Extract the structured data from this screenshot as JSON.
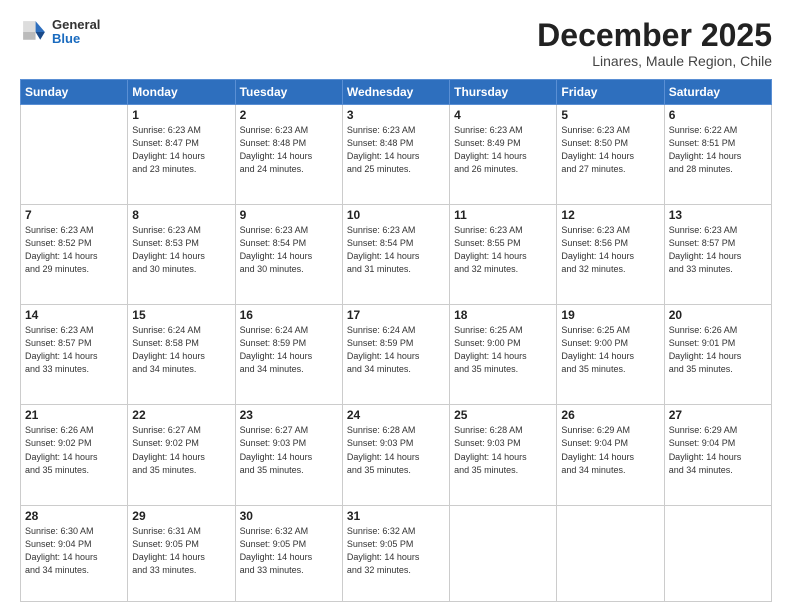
{
  "header": {
    "logo_general": "General",
    "logo_blue": "Blue",
    "month": "December 2025",
    "location": "Linares, Maule Region, Chile"
  },
  "weekdays": [
    "Sunday",
    "Monday",
    "Tuesday",
    "Wednesday",
    "Thursday",
    "Friday",
    "Saturday"
  ],
  "weeks": [
    [
      {
        "day": "",
        "info": ""
      },
      {
        "day": "1",
        "info": "Sunrise: 6:23 AM\nSunset: 8:47 PM\nDaylight: 14 hours\nand 23 minutes."
      },
      {
        "day": "2",
        "info": "Sunrise: 6:23 AM\nSunset: 8:48 PM\nDaylight: 14 hours\nand 24 minutes."
      },
      {
        "day": "3",
        "info": "Sunrise: 6:23 AM\nSunset: 8:48 PM\nDaylight: 14 hours\nand 25 minutes."
      },
      {
        "day": "4",
        "info": "Sunrise: 6:23 AM\nSunset: 8:49 PM\nDaylight: 14 hours\nand 26 minutes."
      },
      {
        "day": "5",
        "info": "Sunrise: 6:23 AM\nSunset: 8:50 PM\nDaylight: 14 hours\nand 27 minutes."
      },
      {
        "day": "6",
        "info": "Sunrise: 6:22 AM\nSunset: 8:51 PM\nDaylight: 14 hours\nand 28 minutes."
      }
    ],
    [
      {
        "day": "7",
        "info": "Sunrise: 6:23 AM\nSunset: 8:52 PM\nDaylight: 14 hours\nand 29 minutes."
      },
      {
        "day": "8",
        "info": "Sunrise: 6:23 AM\nSunset: 8:53 PM\nDaylight: 14 hours\nand 30 minutes."
      },
      {
        "day": "9",
        "info": "Sunrise: 6:23 AM\nSunset: 8:54 PM\nDaylight: 14 hours\nand 30 minutes."
      },
      {
        "day": "10",
        "info": "Sunrise: 6:23 AM\nSunset: 8:54 PM\nDaylight: 14 hours\nand 31 minutes."
      },
      {
        "day": "11",
        "info": "Sunrise: 6:23 AM\nSunset: 8:55 PM\nDaylight: 14 hours\nand 32 minutes."
      },
      {
        "day": "12",
        "info": "Sunrise: 6:23 AM\nSunset: 8:56 PM\nDaylight: 14 hours\nand 32 minutes."
      },
      {
        "day": "13",
        "info": "Sunrise: 6:23 AM\nSunset: 8:57 PM\nDaylight: 14 hours\nand 33 minutes."
      }
    ],
    [
      {
        "day": "14",
        "info": "Sunrise: 6:23 AM\nSunset: 8:57 PM\nDaylight: 14 hours\nand 33 minutes."
      },
      {
        "day": "15",
        "info": "Sunrise: 6:24 AM\nSunset: 8:58 PM\nDaylight: 14 hours\nand 34 minutes."
      },
      {
        "day": "16",
        "info": "Sunrise: 6:24 AM\nSunset: 8:59 PM\nDaylight: 14 hours\nand 34 minutes."
      },
      {
        "day": "17",
        "info": "Sunrise: 6:24 AM\nSunset: 8:59 PM\nDaylight: 14 hours\nand 34 minutes."
      },
      {
        "day": "18",
        "info": "Sunrise: 6:25 AM\nSunset: 9:00 PM\nDaylight: 14 hours\nand 35 minutes."
      },
      {
        "day": "19",
        "info": "Sunrise: 6:25 AM\nSunset: 9:00 PM\nDaylight: 14 hours\nand 35 minutes."
      },
      {
        "day": "20",
        "info": "Sunrise: 6:26 AM\nSunset: 9:01 PM\nDaylight: 14 hours\nand 35 minutes."
      }
    ],
    [
      {
        "day": "21",
        "info": "Sunrise: 6:26 AM\nSunset: 9:02 PM\nDaylight: 14 hours\nand 35 minutes."
      },
      {
        "day": "22",
        "info": "Sunrise: 6:27 AM\nSunset: 9:02 PM\nDaylight: 14 hours\nand 35 minutes."
      },
      {
        "day": "23",
        "info": "Sunrise: 6:27 AM\nSunset: 9:03 PM\nDaylight: 14 hours\nand 35 minutes."
      },
      {
        "day": "24",
        "info": "Sunrise: 6:28 AM\nSunset: 9:03 PM\nDaylight: 14 hours\nand 35 minutes."
      },
      {
        "day": "25",
        "info": "Sunrise: 6:28 AM\nSunset: 9:03 PM\nDaylight: 14 hours\nand 35 minutes."
      },
      {
        "day": "26",
        "info": "Sunrise: 6:29 AM\nSunset: 9:04 PM\nDaylight: 14 hours\nand 34 minutes."
      },
      {
        "day": "27",
        "info": "Sunrise: 6:29 AM\nSunset: 9:04 PM\nDaylight: 14 hours\nand 34 minutes."
      }
    ],
    [
      {
        "day": "28",
        "info": "Sunrise: 6:30 AM\nSunset: 9:04 PM\nDaylight: 14 hours\nand 34 minutes."
      },
      {
        "day": "29",
        "info": "Sunrise: 6:31 AM\nSunset: 9:05 PM\nDaylight: 14 hours\nand 33 minutes."
      },
      {
        "day": "30",
        "info": "Sunrise: 6:32 AM\nSunset: 9:05 PM\nDaylight: 14 hours\nand 33 minutes."
      },
      {
        "day": "31",
        "info": "Sunrise: 6:32 AM\nSunset: 9:05 PM\nDaylight: 14 hours\nand 32 minutes."
      },
      {
        "day": "",
        "info": ""
      },
      {
        "day": "",
        "info": ""
      },
      {
        "day": "",
        "info": ""
      }
    ]
  ]
}
